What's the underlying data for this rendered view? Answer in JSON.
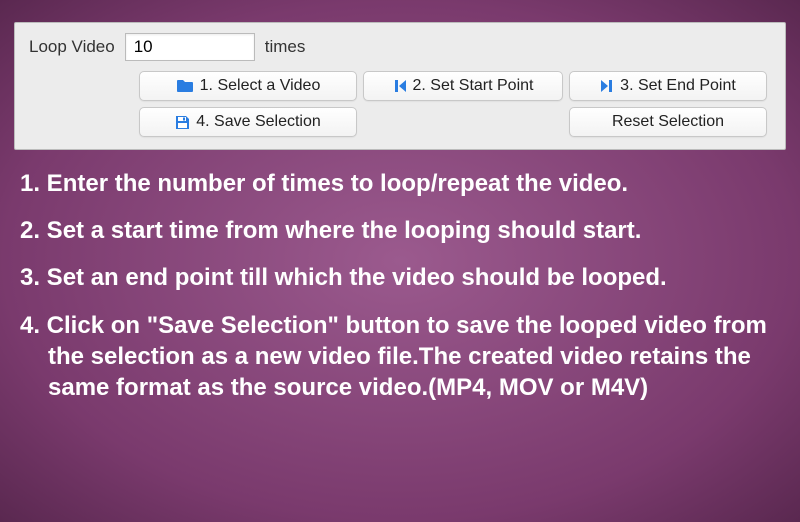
{
  "panel": {
    "loop_label": "Loop Video",
    "loop_value": "10",
    "times_label": "times",
    "buttons": {
      "select_video": "1. Select a Video",
      "set_start": "2. Set Start Point",
      "set_end": "3. Set End Point",
      "save_selection": "4. Save Selection",
      "reset_selection": "Reset Selection"
    }
  },
  "instructions": {
    "step1": "1. Enter the number of times to loop/repeat the video.",
    "step2": "2. Set a start time from where the looping should start.",
    "step3": "3. Set an end point till which the video should be looped.",
    "step4": "4. Click on \"Save Selection\" button to save the looped video from the selection as a new video file.The created video retains the same format as the source video.(MP4, MOV or M4V)"
  }
}
